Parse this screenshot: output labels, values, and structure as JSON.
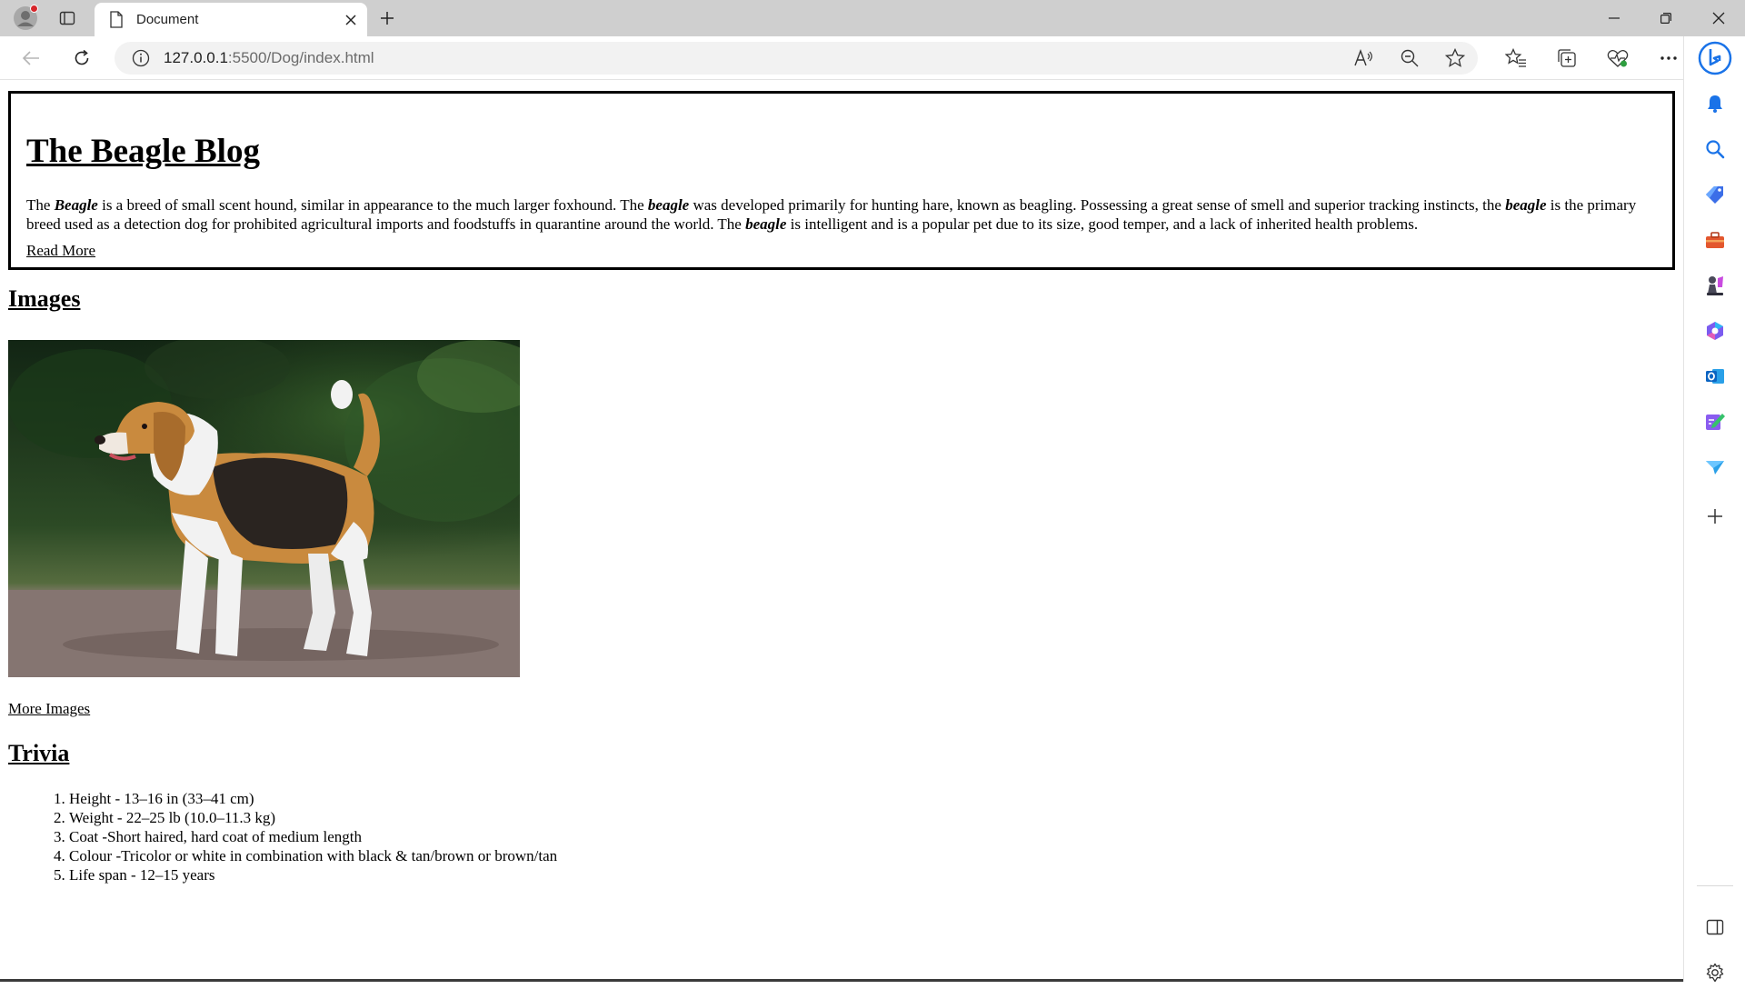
{
  "browser": {
    "tab": {
      "title": "Document"
    },
    "address": {
      "host": "127.0.0.1",
      "path": ":5500/Dog/index.html"
    }
  },
  "page": {
    "title": "The Beagle Blog",
    "intro": {
      "p1": "The ",
      "i1": "Beagle",
      "p2": " is a breed of small scent hound, similar in appearance to the much larger foxhound. The ",
      "i2": "beagle",
      "p3": " was developed primarily for hunting hare, known as beagling. Possessing a great sense of smell and superior tracking instincts, the ",
      "i3": "beagle",
      "p4": " is the primary breed used as a detection dog for prohibited agricultural imports and foodstuffs in quarantine around the world. The ",
      "i4": "beagle",
      "p5": " is intelligent and is a popular pet due to its size, good temper, and a lack of inherited health problems."
    },
    "read_more": "Read More",
    "images_heading": "Images",
    "more_images": "More Images",
    "trivia_heading": "Trivia",
    "trivia": [
      "Height - 13–16 in (33–41 cm)",
      "Weight - 22–25 lb (10.0–11.3 kg)",
      "Coat -Short haired, hard coat of medium length",
      "Colour -Tricolor or white in combination with black & tan/brown or brown/tan",
      "Life span - 12–15 years"
    ]
  },
  "colors": {
    "tabbar": "#cfcfcf",
    "bing_blue": "#1a73e8",
    "profile_dot": "#d6262b"
  }
}
